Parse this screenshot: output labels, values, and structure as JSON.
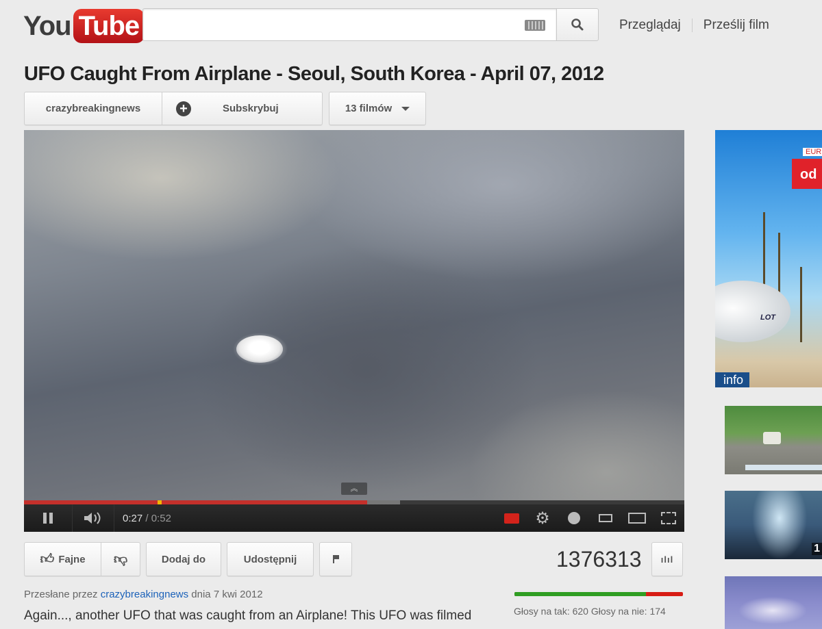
{
  "header": {
    "logo_you": "You",
    "logo_tube": "Tube",
    "search_placeholder": "",
    "nav": [
      "Przeglądaj",
      "Prześlij film"
    ]
  },
  "video": {
    "title": "UFO Caught From Airplane - Seoul, South Korea - April 07, 2012",
    "channel": "crazybreakingnews",
    "subscribe_label": "Subskrybuj",
    "films_label": "13 filmów",
    "player": {
      "current_time": "0:27",
      "separator": " / ",
      "duration": "0:52",
      "progress_fraction": 0.5192,
      "buffered_fraction": 0.57
    }
  },
  "actions": {
    "like_label": "Fajne",
    "add_label": "Dodaj do",
    "share_label": "Udostępnij",
    "views": "1376313"
  },
  "meta": {
    "uploaded_prefix": "Przesłane przez ",
    "uploader": "crazybreakingnews",
    "uploaded_suffix": " dnia 7 kwi 2012",
    "description": "Again..., another UFO that was caught from an Airplane! This UFO was filmed",
    "votes_text": "Głosy na tak: 620 Głosy na nie: 174",
    "likes": 620,
    "dislikes": 174
  },
  "sidebar": {
    "ad_top_text": "EUR",
    "ad_od": "od",
    "ad_brand": "LOT",
    "ad_info": "info",
    "thumb2_duration": "1"
  },
  "colors": {
    "brand_red": "#c4302b",
    "like_green": "#2f9e22",
    "dislike_red": "#d71c14",
    "link_blue": "#1c62b9"
  }
}
